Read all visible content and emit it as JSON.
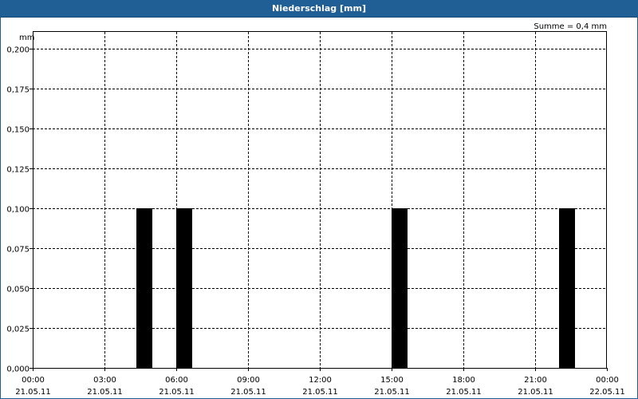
{
  "window": {
    "title": "Niederschlag [mm]"
  },
  "chart_data": {
    "type": "bar",
    "title": "Niederschlag [mm]",
    "ylabel": "mm",
    "annotation": "Summe = 0,4 mm",
    "ylim": [
      0,
      0.2
    ],
    "xlim": [
      "21.05.11 00:00",
      "22.05.11 00:00"
    ],
    "grid": true,
    "y_ticks": [
      "0,000",
      "0,025",
      "0,050",
      "0,075",
      "0,100",
      "0,125",
      "0,150",
      "0,175",
      "0,200"
    ],
    "x_ticks": [
      {
        "time": "00:00",
        "date": "21.05.11"
      },
      {
        "time": "03:00",
        "date": "21.05.11"
      },
      {
        "time": "06:00",
        "date": "21.05.11"
      },
      {
        "time": "09:00",
        "date": "21.05.11"
      },
      {
        "time": "12:00",
        "date": "21.05.11"
      },
      {
        "time": "15:00",
        "date": "21.05.11"
      },
      {
        "time": "18:00",
        "date": "21.05.11"
      },
      {
        "time": "21:00",
        "date": "21.05.11"
      },
      {
        "time": "00:00",
        "date": "22.05.11"
      }
    ],
    "bars": [
      {
        "start": "21.05.11 04:20",
        "end": "21.05.11 05:00",
        "value": 0.1
      },
      {
        "start": "21.05.11 06:00",
        "end": "21.05.11 06:40",
        "value": 0.1
      },
      {
        "start": "21.05.11 15:00",
        "end": "21.05.11 15:40",
        "value": 0.1
      },
      {
        "start": "21.05.11 22:00",
        "end": "21.05.11 22:40",
        "value": 0.1
      }
    ],
    "colors": {
      "bar": "#000000",
      "titlebar": "#1f5f96",
      "grid": "#000000"
    }
  }
}
